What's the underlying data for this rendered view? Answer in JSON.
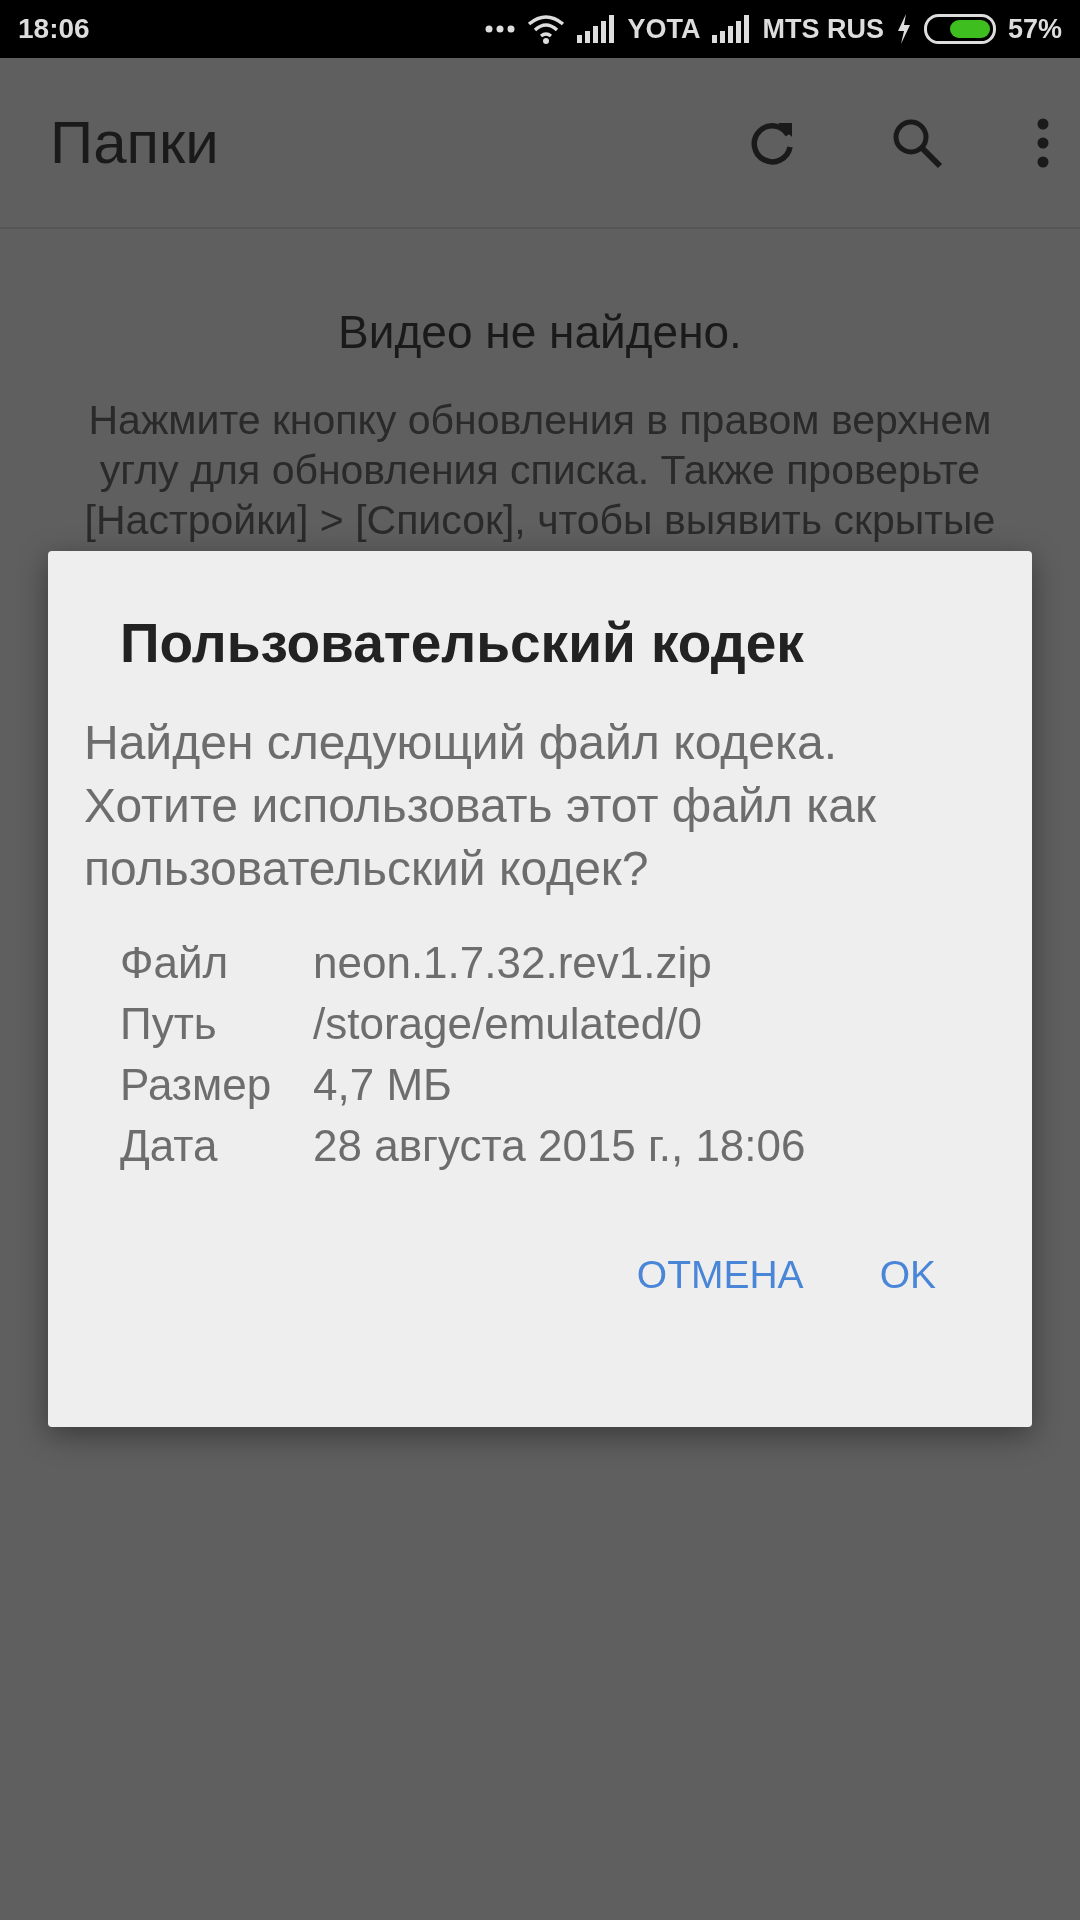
{
  "status_bar": {
    "time": "18:06",
    "carriers": [
      "YOTA",
      "MTS RUS"
    ],
    "charging": true,
    "battery": "57%"
  },
  "toolbar": {
    "title": "Папки"
  },
  "empty_state": {
    "title": "Видео не найдено.",
    "message_lines": [
      "Нажмите кнопку обновления в правом верхнем",
      "углу для обновления списка. Также проверьте",
      "[Настройки] > [Список], чтобы выявить скрытые"
    ]
  },
  "dialog": {
    "title": "Пользовательский кодек",
    "message": "Найден следующий файл кодека. Хотите использовать этот файл как пользовательский кодек?",
    "details": [
      {
        "label": "Файл",
        "value": "neon.1.7.32.rev1.zip"
      },
      {
        "label": "Путь",
        "value": "/storage/emulated/0"
      },
      {
        "label": "Размер",
        "value": "4,7 МБ"
      },
      {
        "label": "Дата",
        "value": "28 августа 2015 г., 18:06"
      }
    ],
    "buttons": [
      "ОТМЕНА",
      "OK"
    ]
  }
}
